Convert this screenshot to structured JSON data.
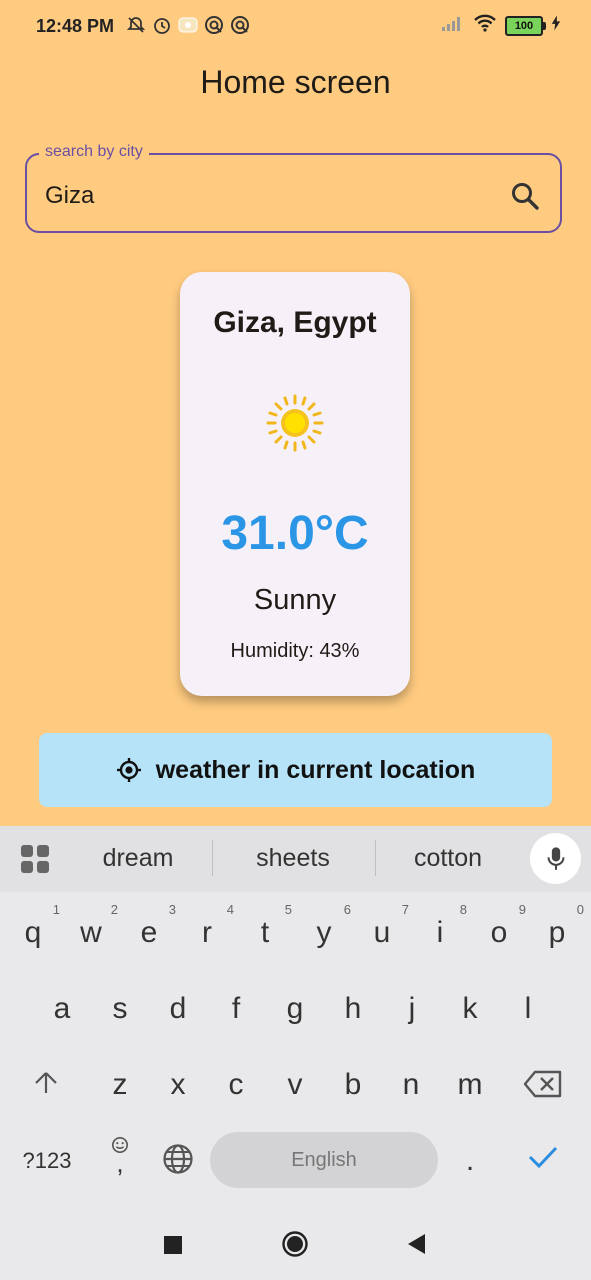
{
  "status_bar": {
    "time": "12:48 PM",
    "battery_level": "100",
    "icons": [
      "mute-icon",
      "alarm-icon",
      "media-icon",
      "sync-icon",
      "sync-icon",
      "signal-icon",
      "wifi-icon",
      "battery-icon",
      "charging-icon"
    ]
  },
  "page": {
    "title": "Home screen"
  },
  "search": {
    "label": "search by city",
    "value": "Giza"
  },
  "weather": {
    "city": "Giza, Egypt",
    "icon": "sun-icon",
    "temperature": "31.0°C",
    "condition": "Sunny",
    "humidity": "Humidity: 43%",
    "temperature_color": "#2b95e6"
  },
  "location_button": {
    "label": "weather in current location"
  },
  "keyboard": {
    "suggestions": [
      "dream",
      "sheets",
      "cotton"
    ],
    "row1": [
      "q",
      "w",
      "e",
      "r",
      "t",
      "y",
      "u",
      "i",
      "o",
      "p"
    ],
    "row1_hints": [
      "1",
      "2",
      "3",
      "4",
      "5",
      "6",
      "7",
      "8",
      "9",
      "0"
    ],
    "row2": [
      "a",
      "s",
      "d",
      "f",
      "g",
      "h",
      "j",
      "k",
      "l"
    ],
    "row3": [
      "z",
      "x",
      "c",
      "v",
      "b",
      "n",
      "m"
    ],
    "symbols_key": "?123",
    "comma_key": ",",
    "period_key": ".",
    "space_label": "English"
  },
  "colors": {
    "background": "#FFCB80",
    "accent": "#6a4fa3",
    "button": "#B6E3F7",
    "card": "#F6F0F8"
  }
}
